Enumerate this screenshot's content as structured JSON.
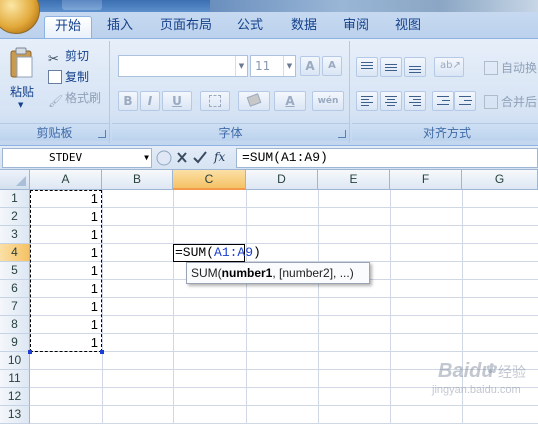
{
  "tabs": [
    "开始",
    "插入",
    "页面布局",
    "公式",
    "数据",
    "审阅",
    "视图"
  ],
  "active_tab": "开始",
  "clipboard": {
    "paste_label": "粘贴",
    "cut_label": "剪切",
    "copy_label": "复制",
    "format_painter_label": "格式刷",
    "group_label": "剪贴板"
  },
  "font": {
    "font_name_value": "",
    "font_size_value": "11",
    "grow_label": "A",
    "shrink_label": "A",
    "bold_label": "B",
    "italic_label": "I",
    "underline_label": "U",
    "font_color_label": "A",
    "phonetic_label": "wén",
    "group_label": "字体"
  },
  "alignment": {
    "wrap_text_label": "自动换",
    "merge_center_label": "合并后",
    "group_label": "对齐方式"
  },
  "formula_bar": {
    "name_box_value": "STDEV",
    "fx_label": "fx",
    "formula_value": "=SUM(A1:A9)"
  },
  "sheet": {
    "columns": [
      "A",
      "B",
      "C",
      "D",
      "E",
      "F",
      "G"
    ],
    "selected_column": "C",
    "rows": [
      "1",
      "2",
      "3",
      "4",
      "5",
      "6",
      "7",
      "8",
      "9",
      "10",
      "11",
      "12",
      "13"
    ],
    "selected_row": "4",
    "column_a_values": [
      "1",
      "1",
      "1",
      "1",
      "1",
      "1",
      "1",
      "1",
      "1"
    ],
    "edit_prefix": "=SUM(",
    "edit_ref": "A1:A9",
    "edit_suffix": ")",
    "tooltip_func": "SUM(",
    "tooltip_arg1": "number1",
    "tooltip_rest": ", [number2], ...)"
  },
  "watermark": {
    "logo_text": "Baidu",
    "sub_text": "经验",
    "url_text": "jingyan.baidu.com"
  },
  "colors": {
    "selected_header": "#f5c265",
    "ribbon_bg": "#d5e3f4",
    "reference_blue": "#1a3fd0"
  }
}
